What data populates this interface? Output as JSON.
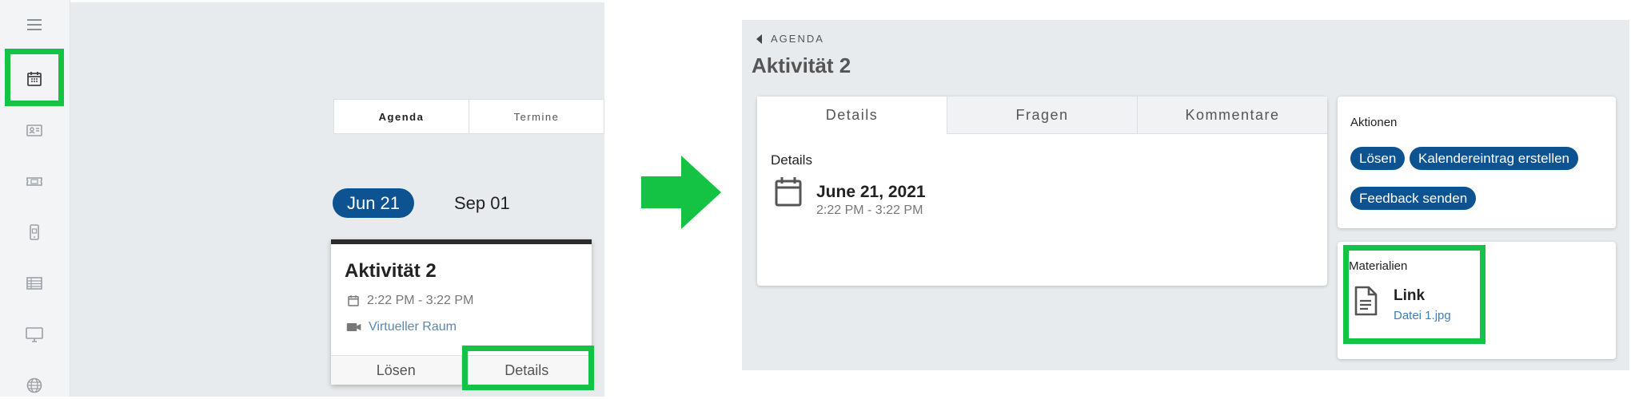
{
  "left_screen": {
    "sidebar": {
      "items": [
        {
          "icon": "menu-icon"
        },
        {
          "icon": "calendar-icon",
          "highlighted": true
        },
        {
          "icon": "contact-card-icon"
        },
        {
          "icon": "ticket-icon"
        },
        {
          "icon": "mobile-device-icon"
        },
        {
          "icon": "table-icon"
        },
        {
          "icon": "monitor-icon"
        },
        {
          "icon": "globe-icon"
        }
      ]
    },
    "tabs": [
      {
        "label": "Agenda",
        "active": true
      },
      {
        "label": "Termine",
        "active": false
      }
    ],
    "dates": {
      "selected": "Jun 21",
      "other": "Sep 01"
    },
    "activity_card": {
      "title": "Aktivität 2",
      "time": "2:22 PM - 3:22 PM",
      "room": "Virtueller Raum",
      "buttons": {
        "solve": "Lösen",
        "details": "Details"
      }
    }
  },
  "right_screen": {
    "breadcrumb": "AGENDA",
    "title": "Aktivität 2",
    "tabs": [
      {
        "label": "Details",
        "active": true
      },
      {
        "label": "Fragen",
        "active": false
      },
      {
        "label": "Kommentare",
        "active": false
      }
    ],
    "details": {
      "section_label": "Details",
      "date": "June 21, 2021",
      "time": "2:22 PM - 3:22 PM"
    },
    "actions": {
      "label": "Aktionen",
      "buttons": [
        "Lösen",
        "Kalendereintrag erstellen",
        "Feedback senden"
      ]
    },
    "materials": {
      "label": "Materialien",
      "item_name": "Link",
      "item_file": "Datei 1.jpg"
    }
  },
  "colors": {
    "highlight": "#14c244",
    "brand_blue": "#0d5291",
    "arrow": "#14c244",
    "background_gray": "#e8ebed"
  }
}
